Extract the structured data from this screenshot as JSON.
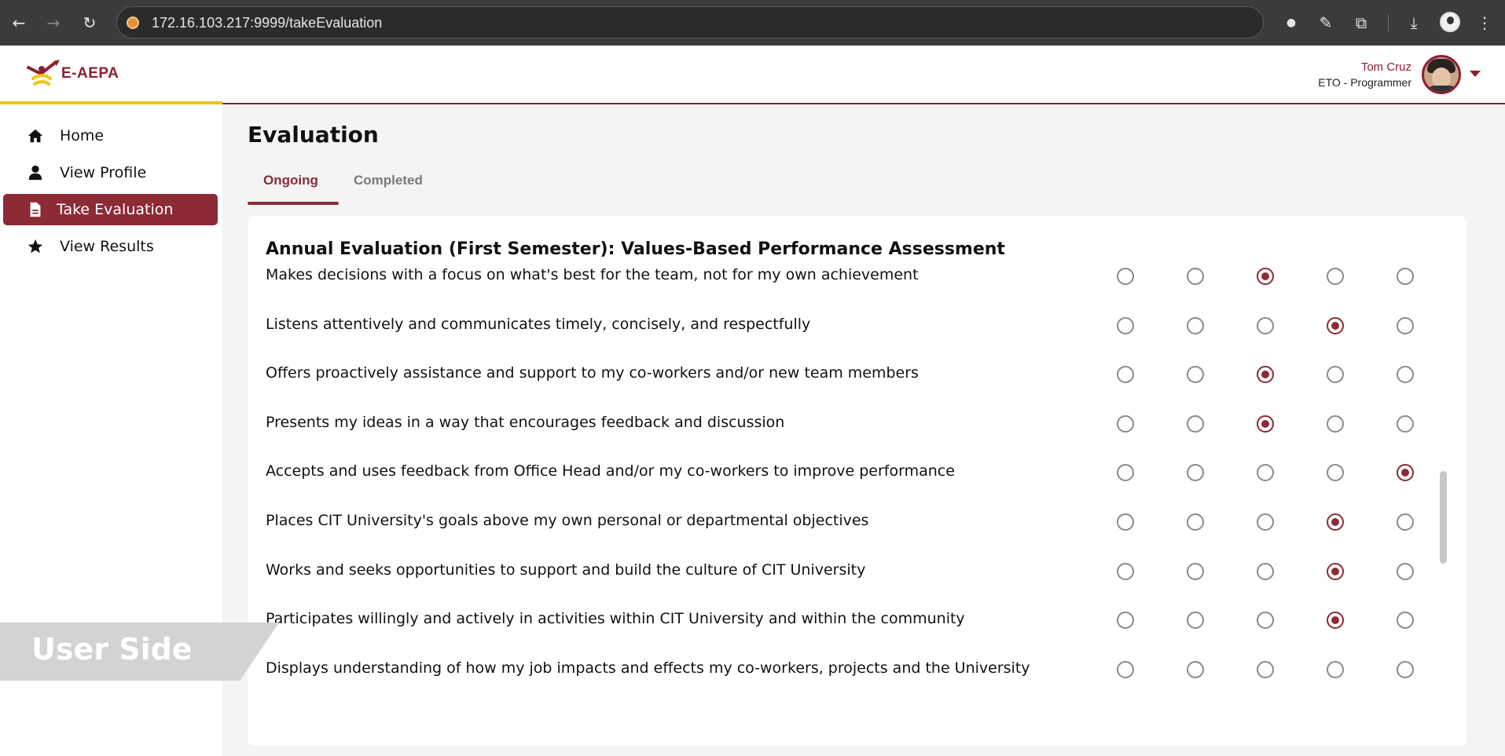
{
  "browser": {
    "url": "172.16.103.217:9999/takeEvaluation",
    "icons": [
      "back-icon",
      "forward-icon",
      "reload-icon",
      "site-info-icon",
      "eyedropper-icon",
      "extensions-icon",
      "download-icon",
      "profile-icon",
      "menu-dots-icon"
    ]
  },
  "header": {
    "logo_text": "E-AEPA",
    "user_name": "Tom Cruz",
    "user_role": "ETO - Programmer"
  },
  "sidebar": {
    "items": [
      {
        "label": "Home",
        "icon": "home-icon"
      },
      {
        "label": "View Profile",
        "icon": "user-icon"
      },
      {
        "label": "Take Evaluation",
        "icon": "document-icon",
        "active": true
      },
      {
        "label": "View Results",
        "icon": "star-icon"
      }
    ]
  },
  "main": {
    "title": "Evaluation",
    "tabs": [
      {
        "label": "Ongoing",
        "active": true
      },
      {
        "label": "Completed",
        "active": false
      }
    ],
    "card": {
      "title": "Annual Evaluation (First Semester): Values-Based Performance Assessment",
      "questions": [
        {
          "text": "Makes decisions with a focus on what's best for the team, not for my own achievement",
          "selected": 3
        },
        {
          "text": "Listens attentively and communicates timely, concisely, and respectfully",
          "selected": 4
        },
        {
          "text": "Offers proactively assistance and support to my co-workers and/or new team members",
          "selected": 3
        },
        {
          "text": "Presents my ideas in a way that encourages feedback and discussion",
          "selected": 3
        },
        {
          "text": "Accepts and uses feedback from Office Head and/or my co-workers to improve performance",
          "selected": 5
        },
        {
          "text": "Places CIT University's goals above my own personal or departmental objectives",
          "selected": 4
        },
        {
          "text": "Works and seeks opportunities to support and build the culture of CIT University",
          "selected": 4
        },
        {
          "text": "Participates willingly and actively in activities within CIT University and within the community",
          "selected": 4
        },
        {
          "text": "Displays understanding of how my job impacts and effects my co-workers, projects and the University",
          "selected": 0
        }
      ]
    }
  },
  "watermark": {
    "text": "User Side"
  },
  "colors": {
    "brand": "#8c2a36",
    "accent_yellow": "#f3c316",
    "background": "#f4f3f5"
  }
}
